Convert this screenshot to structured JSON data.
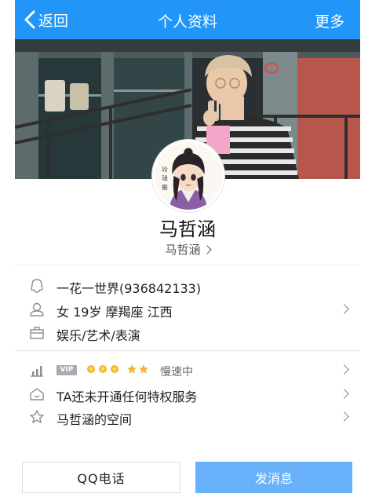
{
  "nav": {
    "back_label": "返回",
    "title": "个人资料",
    "more_label": "更多"
  },
  "profile": {
    "name": "马哲涵",
    "remark": "马哲涵"
  },
  "info": {
    "qq": "一花一世界(936842133)",
    "basic": "女 19岁 摩羯座 江西",
    "job": "娱乐/艺术/表演"
  },
  "level": {
    "vip_badge": "VIP",
    "crowns": 3,
    "half_crowns": 2,
    "speed": "慢速中"
  },
  "privilege": {
    "label": "TA还未开通任何特权服务"
  },
  "space": {
    "label": "马哲涵的空间"
  },
  "bottom": {
    "call_label": "QQ电话",
    "message_label": "发消息"
  },
  "colors": {
    "nav_bg": "#2196f8",
    "message_button": "#69b1fb"
  },
  "icons": {
    "back": "chevron-left-icon",
    "qq": "qq-penguin-icon",
    "person": "user-icon",
    "job": "briefcase-icon",
    "level": "level-bars-icon",
    "privilege": "privilege-house-icon",
    "space": "star-outline-icon"
  }
}
